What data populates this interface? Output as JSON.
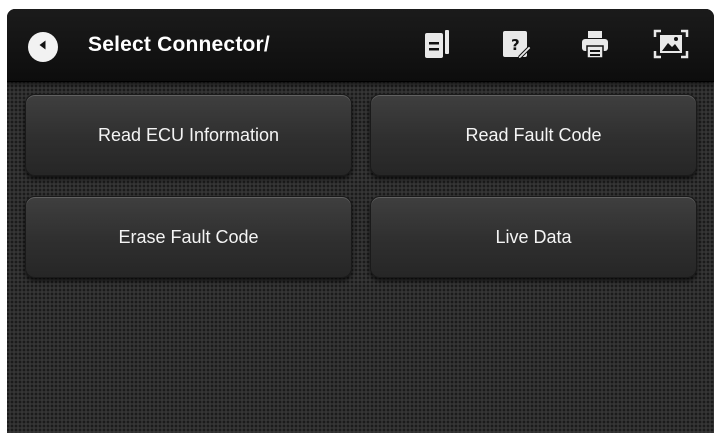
{
  "header": {
    "title": "Select Connector/",
    "icons": [
      "back-icon",
      "document-icon",
      "help-icon",
      "print-icon",
      "screenshot-icon"
    ]
  },
  "functions": [
    {
      "label": "Read ECU Information"
    },
    {
      "label": "Read Fault Code"
    },
    {
      "label": "Erase Fault Code"
    },
    {
      "label": "Live Data"
    }
  ],
  "colors": {
    "header_bg": "#111111",
    "background": "#2e2e2e",
    "button_bg": "#353535",
    "text": "#ffffff"
  }
}
